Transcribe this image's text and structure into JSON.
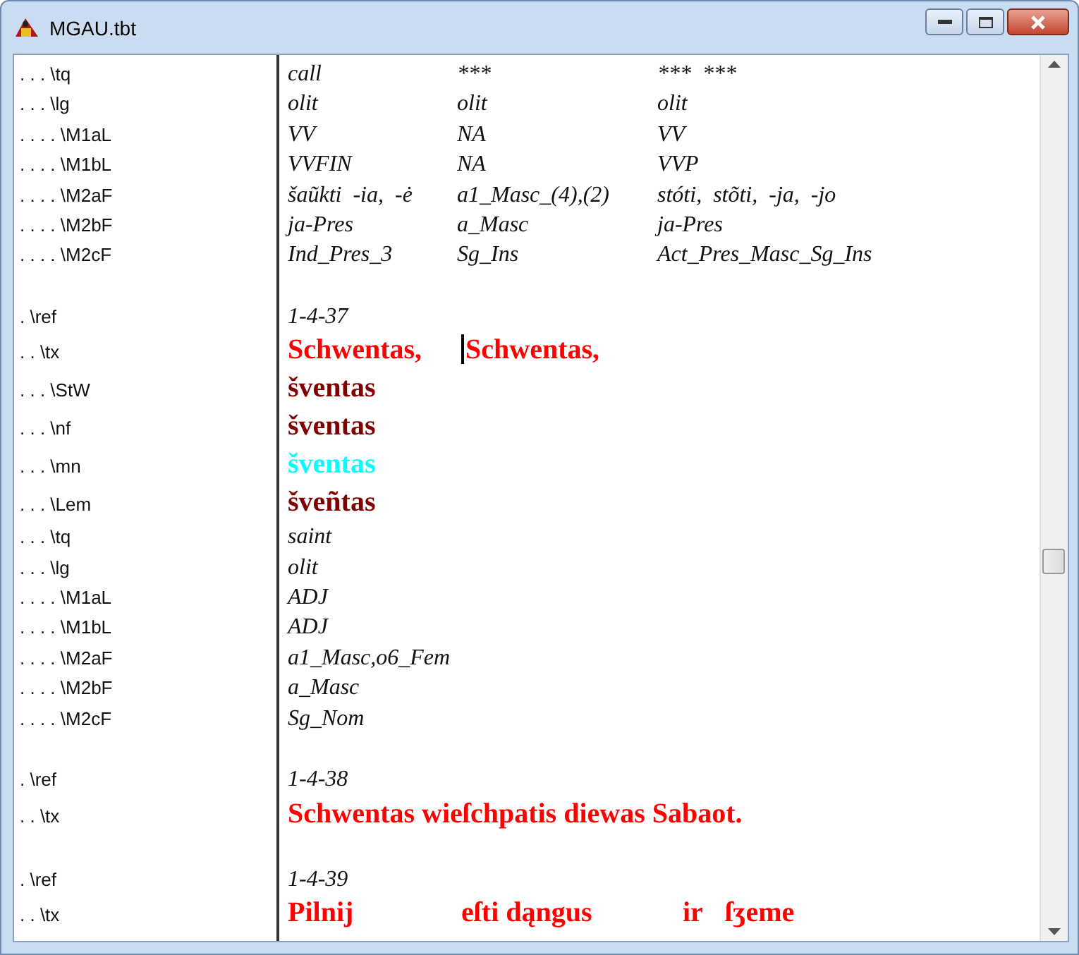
{
  "window": {
    "title": "MGAU.tbt"
  },
  "rows": [
    {
      "marker": ". . . \\tq",
      "kind": "gloss",
      "cells": [
        {
          "text": "call"
        },
        {
          "text": "***"
        },
        {
          "text": "***  ***"
        }
      ]
    },
    {
      "marker": ". . . \\lg",
      "kind": "gloss",
      "cells": [
        {
          "text": "olit"
        },
        {
          "text": "olit"
        },
        {
          "text": "olit"
        }
      ]
    },
    {
      "marker": ". . . . \\M1aL",
      "kind": "gloss",
      "cells": [
        {
          "text": "VV"
        },
        {
          "text": "NA"
        },
        {
          "text": "VV"
        }
      ]
    },
    {
      "marker": ". . . . \\M1bL",
      "kind": "gloss",
      "cells": [
        {
          "text": "VVFIN"
        },
        {
          "text": "NA"
        },
        {
          "text": "VVP"
        }
      ]
    },
    {
      "marker": ". . . . \\M2aF",
      "kind": "gloss",
      "cells": [
        {
          "text": "šaũkti  -ia,  -ė"
        },
        {
          "text": "a1_Masc_(4),(2)"
        },
        {
          "text": "stóti,  stõti,  -ja,  -jo"
        }
      ]
    },
    {
      "marker": ". . . . \\M2bF",
      "kind": "gloss",
      "cells": [
        {
          "text": "ja-Pres"
        },
        {
          "text": "a_Masc"
        },
        {
          "text": "ja-Pres"
        }
      ]
    },
    {
      "marker": ". . . . \\M2cF",
      "kind": "gloss",
      "cells": [
        {
          "text": "Ind_Pres_3"
        },
        {
          "text": "Sg_Ins"
        },
        {
          "text": "Act_Pres_Masc_Sg_Ins"
        }
      ]
    },
    {
      "kind": "blank"
    },
    {
      "marker": ". \\ref",
      "kind": "gloss",
      "cells": [
        {
          "text": "1-4-37"
        }
      ]
    },
    {
      "marker": ". . \\tx",
      "kind": "text",
      "color": "#ff0000",
      "cells": [
        {
          "text": "Schwentas,",
          "caret": false
        },
        {
          "text": "Schwentas,",
          "caret": true
        }
      ]
    },
    {
      "marker": ". . . \\StW",
      "kind": "text",
      "color": "#800000",
      "cells": [
        {
          "text": "šventas",
          "caret": false
        }
      ]
    },
    {
      "marker": ". . . \\nf",
      "kind": "text",
      "color": "#800000",
      "cells": [
        {
          "text": "šventas",
          "caret": false
        }
      ]
    },
    {
      "marker": ". . . \\mn",
      "kind": "text",
      "color": "#00ffff",
      "cells": [
        {
          "text": "šventas",
          "caret": false
        }
      ]
    },
    {
      "marker": ". . . \\Lem",
      "kind": "text",
      "color": "#800000",
      "cells": [
        {
          "text": "šveñtas",
          "caret": false
        }
      ]
    },
    {
      "marker": ". . . \\tq",
      "kind": "gloss",
      "cells": [
        {
          "text": "saint"
        }
      ]
    },
    {
      "marker": ". . . \\lg",
      "kind": "gloss",
      "cells": [
        {
          "text": "olit"
        }
      ]
    },
    {
      "marker": ". . . . \\M1aL",
      "kind": "gloss",
      "cells": [
        {
          "text": "ADJ"
        }
      ]
    },
    {
      "marker": ". . . . \\M1bL",
      "kind": "gloss",
      "cells": [
        {
          "text": "ADJ"
        }
      ]
    },
    {
      "marker": ". . . . \\M2aF",
      "kind": "gloss",
      "cells": [
        {
          "text": "a1_Masc,o6_Fem"
        }
      ]
    },
    {
      "marker": ". . . . \\M2bF",
      "kind": "gloss",
      "cells": [
        {
          "text": "a_Masc"
        }
      ]
    },
    {
      "marker": ". . . . \\M2cF",
      "kind": "gloss",
      "cells": [
        {
          "text": "Sg_Nom"
        }
      ]
    },
    {
      "kind": "blank"
    },
    {
      "marker": ". \\ref",
      "kind": "gloss",
      "cells": [
        {
          "text": "1-4-38"
        }
      ]
    },
    {
      "marker": ". . \\tx",
      "kind": "text",
      "color": "#ff0000",
      "cells": [
        {
          "text": "Schwentas wieſchpatis diewas Sabaot.",
          "caret": false
        }
      ]
    },
    {
      "kind": "blank"
    },
    {
      "marker": ". \\ref",
      "kind": "gloss",
      "cells": [
        {
          "text": "1-4-39"
        }
      ]
    },
    {
      "marker": ". . \\tx",
      "kind": "text",
      "color": "#ff0000",
      "cells": [
        {
          "text": "Pilnij",
          "caret": false
        },
        {
          "text": "eſti dąngus",
          "caret": false
        },
        {
          "text": "ir",
          "caret": false
        },
        {
          "text": "ſʒeme",
          "caret": false
        }
      ]
    }
  ]
}
